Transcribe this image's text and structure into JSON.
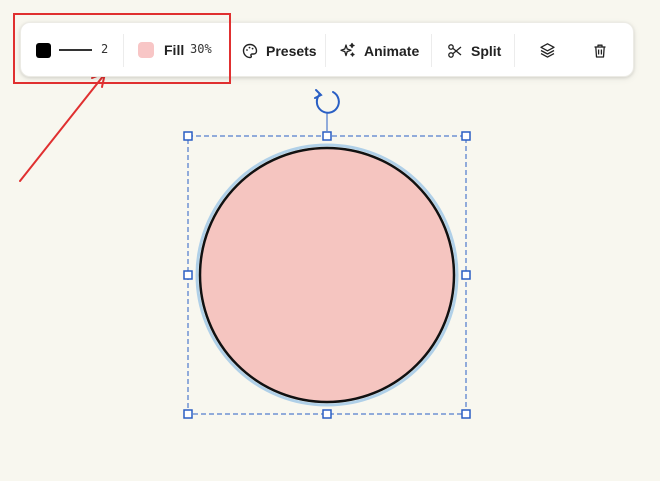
{
  "toolbar": {
    "stroke": {
      "color": "#000000",
      "width": "2"
    },
    "fill": {
      "color": "#f8c6c6",
      "label": "Fill",
      "opacity": "30%"
    },
    "presets_label": "Presets",
    "animate_label": "Animate",
    "split_label": "Split"
  },
  "shape": {
    "type": "circle",
    "fill": "#f5c5c0",
    "stroke": "#111111"
  },
  "colors": {
    "selection": "#2a5fc4",
    "annotation": "#e03030",
    "accent": "#2a5fc4"
  }
}
